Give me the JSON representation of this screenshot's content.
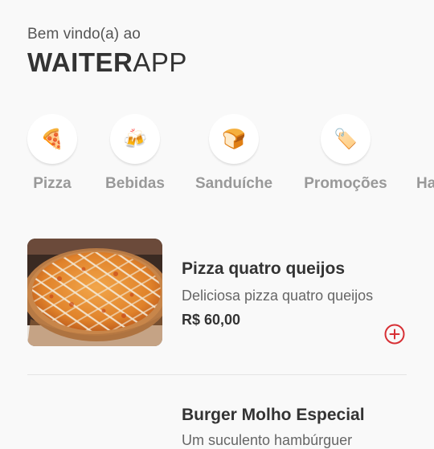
{
  "header": {
    "greeting": "Bem vindo(a) ao",
    "brand_bold": "WAITER",
    "brand_light": "APP"
  },
  "categories": [
    {
      "icon": "pizza-slice-icon",
      "emoji": "🍕",
      "label": "Pizza"
    },
    {
      "icon": "beer-mugs-icon",
      "emoji": "🍻",
      "label": "Bebidas"
    },
    {
      "icon": "sandwich-icon",
      "emoji": "🍞",
      "label": "Sanduíche"
    },
    {
      "icon": "price-tag-icon",
      "emoji": "🏷️",
      "label": "Promoções"
    },
    {
      "icon": "",
      "emoji": "",
      "label": "Ha"
    }
  ],
  "products": [
    {
      "name": "Pizza quatro queijos",
      "description": "Deliciosa pizza quatro queijos",
      "price": "R$ 60,00"
    },
    {
      "name": "Burger Molho Especial",
      "description": "Um suculento hambúrguer",
      "price": ""
    }
  ],
  "colors": {
    "accent": "#d73035",
    "text": "#333333",
    "muted": "#999999",
    "background": "#f9f9f9"
  }
}
